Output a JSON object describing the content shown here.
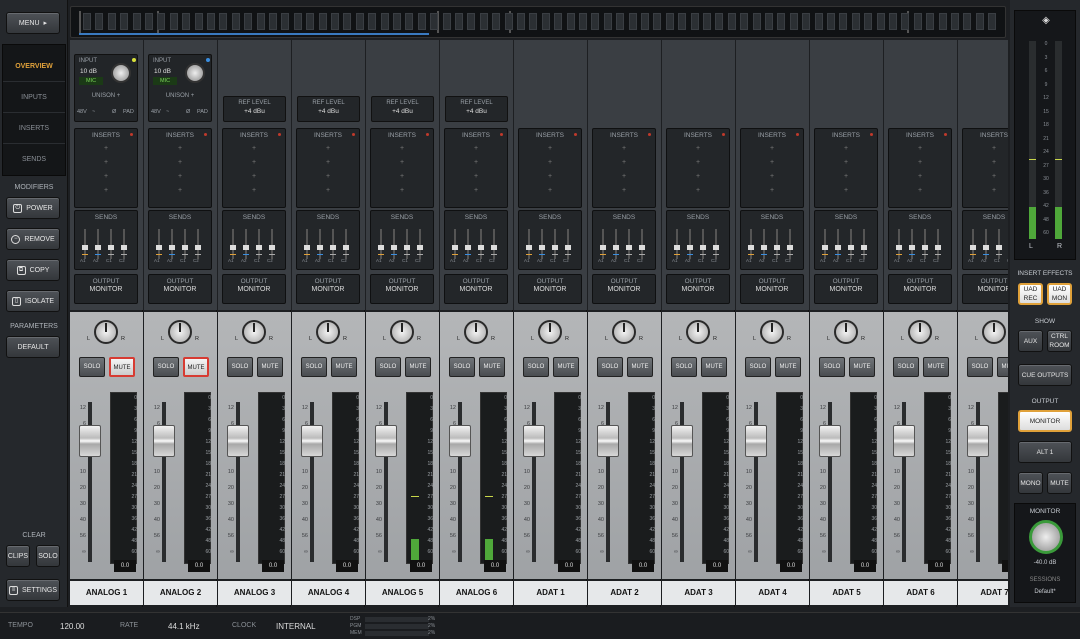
{
  "left": {
    "menu": "MENU",
    "views": [
      "OVERVIEW",
      "INPUTS",
      "INSERTS",
      "SENDS"
    ],
    "modifiers_label": "MODIFIERS",
    "power": "POWER",
    "remove": "REMOVE",
    "copy": "COPY",
    "isolate": "ISOLATE",
    "parameters_label": "PARAMETERS",
    "default": "DEFAULT",
    "clear_label": "CLEAR",
    "clips": "CLIPS",
    "solo": "SOLO",
    "settings": "SETTINGS"
  },
  "strip_labels": {
    "input": "INPUT",
    "gain": "10 dB",
    "mic": "MIC",
    "unison": "UNISON +",
    "phantom": "48V",
    "hpf": "~",
    "phase": "Ø",
    "pad": "PAD",
    "ref_level": "REF LEVEL",
    "ref_value": "+4 dBu",
    "inserts": "INSERTS",
    "sends": "SENDS",
    "output": "OUTPUT",
    "monitor": "MONITOR",
    "solo": "SOLO",
    "mute": "MUTE",
    "pan_l": "L",
    "pan_r": "R",
    "send_tags": [
      "A1",
      "A2",
      "C1",
      "C2"
    ],
    "fader_scale": [
      "12",
      "6",
      "0",
      "5",
      "10",
      "20",
      "30",
      "40",
      "56",
      "∞"
    ],
    "meter_scale": [
      "0",
      "3",
      "6",
      "9",
      "12",
      "15",
      "18",
      "21",
      "24",
      "27",
      "30",
      "36",
      "42",
      "48",
      "60"
    ],
    "value": "0.0"
  },
  "channels": [
    {
      "name": "ANALOG 1",
      "type": "preamp",
      "mute": true,
      "level": 0,
      "led": "yellow"
    },
    {
      "name": "ANALOG 2",
      "type": "preamp",
      "mute": true,
      "level": 0,
      "led": "blue"
    },
    {
      "name": "ANALOG 3",
      "type": "line",
      "mute": false,
      "level": 0
    },
    {
      "name": "ANALOG 4",
      "type": "line",
      "mute": false,
      "level": 0
    },
    {
      "name": "ANALOG 5",
      "type": "line",
      "mute": false,
      "level": 0.14
    },
    {
      "name": "ANALOG 6",
      "type": "line",
      "mute": false,
      "level": 0.14
    },
    {
      "name": "ADAT 1",
      "type": "digital",
      "mute": false,
      "level": 0
    },
    {
      "name": "ADAT 2",
      "type": "digital",
      "mute": false,
      "level": 0
    },
    {
      "name": "ADAT 3",
      "type": "digital",
      "mute": false,
      "level": 0
    },
    {
      "name": "ADAT 4",
      "type": "digital",
      "mute": false,
      "level": 0
    },
    {
      "name": "ADAT 5",
      "type": "digital",
      "mute": false,
      "level": 0
    },
    {
      "name": "ADAT 6",
      "type": "digital",
      "mute": false,
      "level": 0
    },
    {
      "name": "ADAT 7",
      "type": "digital",
      "mute": false,
      "level": 0
    }
  ],
  "right": {
    "meter_l": "L",
    "meter_r": "R",
    "master_scale": [
      "0",
      "3",
      "6",
      "9",
      "12",
      "15",
      "18",
      "21",
      "24",
      "27",
      "30",
      "36",
      "42",
      "48",
      "60"
    ],
    "insert_effects": "INSERT EFFECTS",
    "uad_rec": "UAD REC",
    "uad_mon": "UAD MON",
    "show": "SHOW",
    "aux": "AUX",
    "ctrl_room": "CTRL ROOM",
    "cue_outputs": "CUE OUTPUTS",
    "output": "OUTPUT",
    "monitor_btn": "MONITOR",
    "alt1": "ALT 1",
    "mono": "MONO",
    "mute": "MUTE",
    "monitor_label": "MONITOR",
    "monitor_value": "-40.0 dB",
    "sessions": "SESSIONS",
    "session_name": "Default*"
  },
  "status": {
    "tempo_label": "TEMPO",
    "tempo": "120.00",
    "rate_label": "RATE",
    "rate": "44.1 kHz",
    "clock_label": "CLOCK",
    "clock": "INTERNAL",
    "dsp": "DSP",
    "pgm": "PGM",
    "mem": "MEM",
    "dsp_val": "2%",
    "pgm_val": "2%",
    "mem_val": "2%"
  },
  "colors": {
    "accent": "#e0a13a",
    "mute_red": "#d73b32",
    "meter_green": "#4fa83a",
    "led_yellow": "#d8e03a",
    "led_blue": "#3a8ee0"
  }
}
